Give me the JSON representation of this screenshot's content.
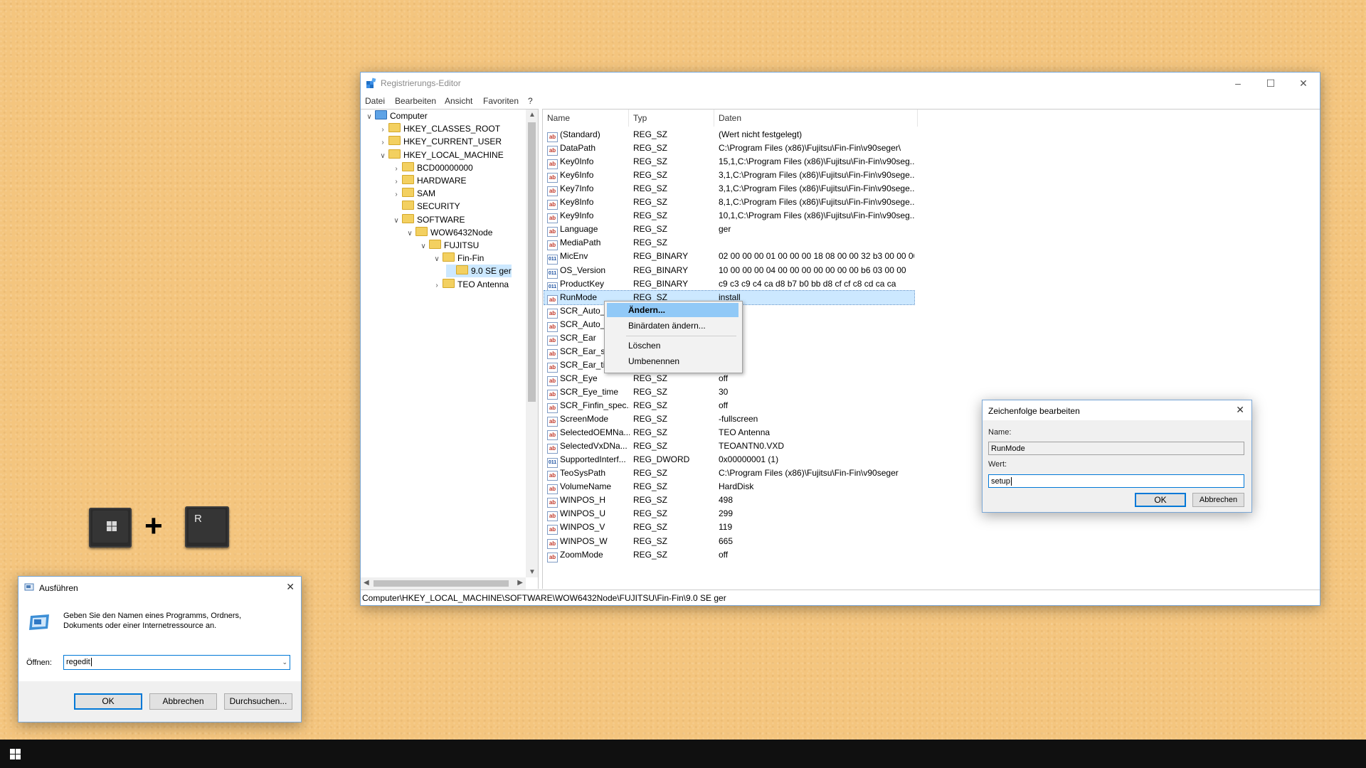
{
  "regedit": {
    "title": "Registrierungs-Editor",
    "menu": [
      "Datei",
      "Bearbeiten",
      "Ansicht",
      "Favoriten",
      "?"
    ],
    "tree": [
      {
        "label": "Computer",
        "exp": "v"
      },
      {
        "label": "HKEY_CLASSES_ROOT",
        "exp": ">"
      },
      {
        "label": "HKEY_CURRENT_USER",
        "exp": ">"
      },
      {
        "label": "HKEY_LOCAL_MACHINE",
        "exp": "v"
      },
      {
        "label": "BCD00000000",
        "exp": ">"
      },
      {
        "label": "HARDWARE",
        "exp": ">"
      },
      {
        "label": "SAM",
        "exp": ">"
      },
      {
        "label": "SECURITY",
        "exp": ""
      },
      {
        "label": "SOFTWARE",
        "exp": "v"
      },
      {
        "label": "WOW6432Node",
        "exp": "v"
      },
      {
        "label": "FUJITSU",
        "exp": "v"
      },
      {
        "label": "Fin-Fin",
        "exp": "v"
      },
      {
        "label": "9.0 SE ger",
        "exp": ""
      },
      {
        "label": "TEO Antenna",
        "exp": ">"
      }
    ],
    "columns": {
      "name": "Name",
      "type": "Typ",
      "data": "Daten"
    },
    "rows": [
      {
        "name": "(Standard)",
        "type": "REG_SZ",
        "data": "(Wert nicht festgelegt)",
        "kind": "str"
      },
      {
        "name": "DataPath",
        "type": "REG_SZ",
        "data": "C:\\Program Files (x86)\\Fujitsu\\Fin-Fin\\v90seger\\",
        "kind": "str"
      },
      {
        "name": "Key0Info",
        "type": "REG_SZ",
        "data": "15,1,C:\\Program Files (x86)\\Fujitsu\\Fin-Fin\\v90seg...",
        "kind": "str"
      },
      {
        "name": "Key6Info",
        "type": "REG_SZ",
        "data": "3,1,C:\\Program Files (x86)\\Fujitsu\\Fin-Fin\\v90sege...",
        "kind": "str"
      },
      {
        "name": "Key7Info",
        "type": "REG_SZ",
        "data": "3,1,C:\\Program Files (x86)\\Fujitsu\\Fin-Fin\\v90sege...",
        "kind": "str"
      },
      {
        "name": "Key8Info",
        "type": "REG_SZ",
        "data": "8,1,C:\\Program Files (x86)\\Fujitsu\\Fin-Fin\\v90sege...",
        "kind": "str"
      },
      {
        "name": "Key9Info",
        "type": "REG_SZ",
        "data": "10,1,C:\\Program Files (x86)\\Fujitsu\\Fin-Fin\\v90seg...",
        "kind": "str"
      },
      {
        "name": "Language",
        "type": "REG_SZ",
        "data": "ger",
        "kind": "str"
      },
      {
        "name": "MediaPath",
        "type": "REG_SZ",
        "data": "",
        "kind": "str"
      },
      {
        "name": "MicEnv",
        "type": "REG_BINARY",
        "data": "02 00 00 00 01 00 00 00 18 08 00 00 32 b3 00 00 00 0...",
        "kind": "bin"
      },
      {
        "name": "OS_Version",
        "type": "REG_BINARY",
        "data": "10 00 00 00 04 00 00 00 00 00 00 00 b6 03 00 00",
        "kind": "bin"
      },
      {
        "name": "ProductKey",
        "type": "REG_BINARY",
        "data": "c9 c3 c9 c4 ca d8 b7 b0 bb d8 cf cf c8 cd ca ca",
        "kind": "bin"
      },
      {
        "name": "RunMode",
        "type": "REG_SZ",
        "data": "install",
        "kind": "str"
      },
      {
        "name": "SCR_Auto_",
        "type": "",
        "data": "",
        "kind": "str"
      },
      {
        "name": "SCR_Auto_",
        "type": "",
        "data": "",
        "kind": "str"
      },
      {
        "name": "SCR_Ear",
        "type": "",
        "data": "",
        "kind": "str"
      },
      {
        "name": "SCR_Ear_se",
        "type": "",
        "data": "",
        "kind": "str"
      },
      {
        "name": "SCR_Ear_tir",
        "type": "",
        "data": "",
        "kind": "str"
      },
      {
        "name": "SCR_Eye",
        "type": "REG_SZ",
        "data": "off",
        "kind": "str"
      },
      {
        "name": "SCR_Eye_time",
        "type": "REG_SZ",
        "data": "30",
        "kind": "str"
      },
      {
        "name": "SCR_Finfin_spec...",
        "type": "REG_SZ",
        "data": "off",
        "kind": "str"
      },
      {
        "name": "ScreenMode",
        "type": "REG_SZ",
        "data": "-fullscreen",
        "kind": "str"
      },
      {
        "name": "SelectedOEMNa...",
        "type": "REG_SZ",
        "data": "TEO Antenna",
        "kind": "str"
      },
      {
        "name": "SelectedVxDNa...",
        "type": "REG_SZ",
        "data": "TEOANTN0.VXD",
        "kind": "str"
      },
      {
        "name": "SupportedInterf...",
        "type": "REG_DWORD",
        "data": "0x00000001 (1)",
        "kind": "bin"
      },
      {
        "name": "TeoSysPath",
        "type": "REG_SZ",
        "data": "C:\\Program Files (x86)\\Fujitsu\\Fin-Fin\\v90seger",
        "kind": "str"
      },
      {
        "name": "VolumeName",
        "type": "REG_SZ",
        "data": "HardDisk",
        "kind": "str"
      },
      {
        "name": "WINPOS_H",
        "type": "REG_SZ",
        "data": "498",
        "kind": "str"
      },
      {
        "name": "WINPOS_U",
        "type": "REG_SZ",
        "data": "299",
        "kind": "str"
      },
      {
        "name": "WINPOS_V",
        "type": "REG_SZ",
        "data": "119",
        "kind": "str"
      },
      {
        "name": "WINPOS_W",
        "type": "REG_SZ",
        "data": "665",
        "kind": "str"
      },
      {
        "name": "ZoomMode",
        "type": "REG_SZ",
        "data": "off",
        "kind": "str"
      }
    ],
    "status": "Computer\\HKEY_LOCAL_MACHINE\\SOFTWARE\\WOW6432Node\\FUJITSU\\Fin-Fin\\9.0 SE ger"
  },
  "context_menu": {
    "items": [
      "Ändern...",
      "Binärdaten ändern...",
      "Löschen",
      "Umbenennen"
    ]
  },
  "edit_dialog": {
    "title": "Zeichenfolge bearbeiten",
    "name_label": "Name:",
    "name_value": "RunMode",
    "value_label": "Wert:",
    "value": "setup",
    "ok": "OK",
    "cancel": "Abbrechen"
  },
  "run_dialog": {
    "title": "Ausführen",
    "description": "Geben Sie den Namen eines Programms, Ordners, Dokuments oder einer Internetressource an.",
    "open_label": "Öffnen:",
    "open_value": "regedit",
    "ok": "OK",
    "cancel": "Abbrechen",
    "browse": "Durchsuchen..."
  },
  "shortcut": {
    "plus": "+",
    "key_letter": "R"
  },
  "icons": {
    "app": "registry-editor-icon",
    "string_value": "string-value-icon",
    "binary_value": "binary-value-icon",
    "folder": "folder-icon",
    "computer": "computer-icon",
    "windows": "windows-logo-icon",
    "run": "run-app-icon"
  },
  "colors": {
    "desktop": "#f4c57e",
    "selection": "#cce8ff",
    "menu_highlight": "#91c9f7",
    "accent": "#0078d7",
    "taskbar": "#101010"
  }
}
